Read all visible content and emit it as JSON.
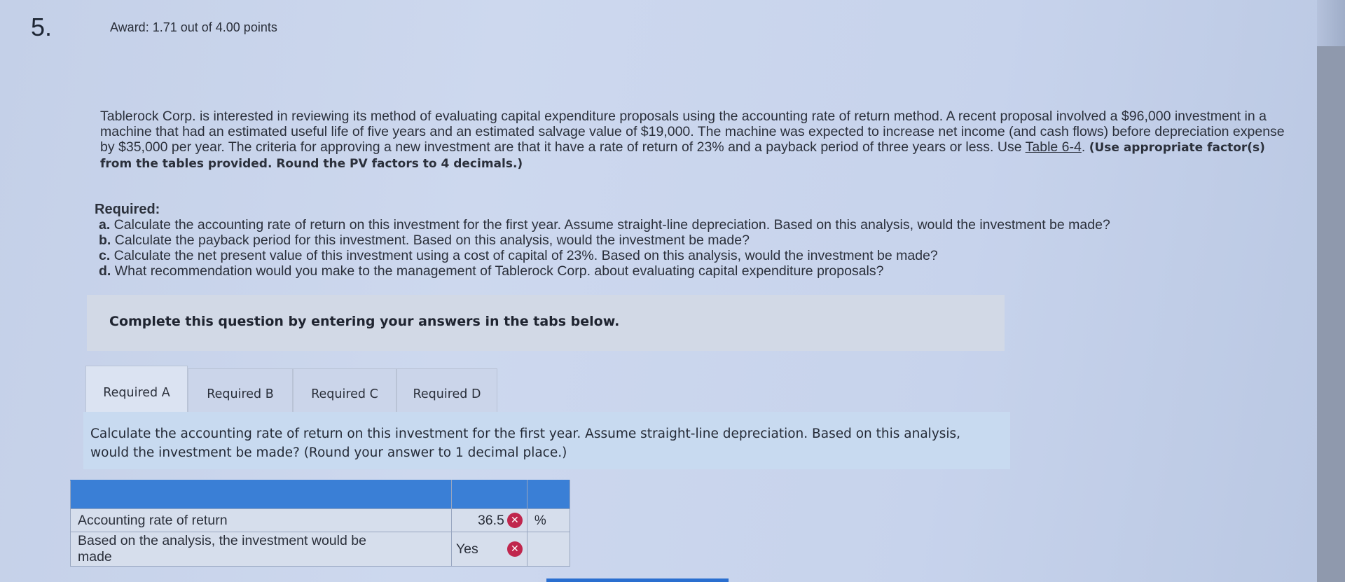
{
  "question": {
    "number": "5.",
    "award": "Award: 1.71 out of 4.00 points"
  },
  "problem": {
    "text": "Tablerock Corp. is interested in reviewing its method of evaluating capital expenditure proposals using the accounting rate of return method. A recent proposal involved a $96,000 investment in a machine that had an estimated useful life of five years and an estimated salvage value of $19,000. The machine was expected to increase net income (and cash flows) before depreciation expense by $35,000 per year. The criteria for approving a new investment are that it have a rate of return of 23% and a payback period of three years or less. Use ",
    "table_link": "Table 6-4",
    "after_link": ". ",
    "instruction": "(Use appropriate factor(s) from the tables provided. Round the PV factors to 4 decimals.)"
  },
  "required": {
    "heading": "Required:",
    "items": [
      {
        "letter": "a.",
        "text": " Calculate the accounting rate of return on this investment for the first year. Assume straight-line depreciation. Based on this analysis, would the investment be made?"
      },
      {
        "letter": "b.",
        "text": " Calculate the payback period for this investment. Based on this analysis, would the investment be made?"
      },
      {
        "letter": "c.",
        "text": " Calculate the net present value of this investment using a cost of capital of 23%. Based on this analysis, would the investment be made?"
      },
      {
        "letter": "d.",
        "text": " What recommendation would you make to the management of Tablerock Corp. about evaluating capital expenditure proposals?"
      }
    ]
  },
  "complete_prompt": "Complete this question by entering your answers in the tabs below.",
  "tabs": [
    {
      "label": "Required A"
    },
    {
      "label": "Required B"
    },
    {
      "label": "Required C"
    },
    {
      "label": "Required D"
    }
  ],
  "active_tab": "Required A",
  "panel_prompt": "Calculate the accounting rate of return on this investment for the first year. Assume straight-line depreciation. Based on this analysis, would the investment be made? (Round your answer to 1 decimal place.)",
  "answer_table": {
    "rows": [
      {
        "label": "Accounting rate of return",
        "value": "36.5",
        "unit": "%",
        "status": "incorrect"
      },
      {
        "label_line1": "Based on the analysis, the investment would be",
        "label_line2": "made",
        "value": "Yes",
        "status": "incorrect"
      }
    ]
  },
  "colors": {
    "header_blue": "#3a7fd6",
    "incorrect_red": "#c0264d"
  },
  "icons": {
    "incorrect": "x-circle-icon"
  }
}
